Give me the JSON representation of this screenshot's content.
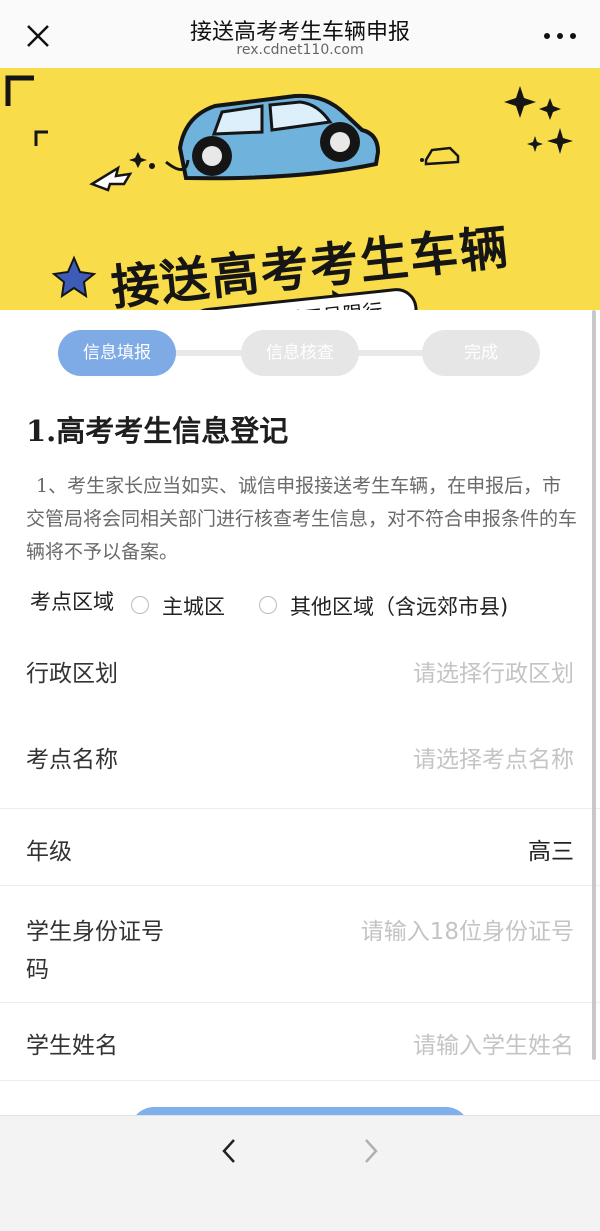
{
  "nav": {
    "title": "接送高考考生车辆申报",
    "url": "rex.cdnet110.com",
    "close_icon": "close-icon",
    "more_icon": "more-icon"
  },
  "banner": {
    "title": "接送高考考生车辆",
    "pill": "申报不受尾号限行",
    "colors": {
      "background": "#f8dc4a",
      "car": "#6fb3dc"
    }
  },
  "steps": [
    {
      "label": "信息填报",
      "active": true
    },
    {
      "label": "信息核查",
      "active": false
    },
    {
      "label": "完成",
      "active": false
    }
  ],
  "section": {
    "title": "1.高考考生信息登记",
    "notice": "1、考生家长应当如实、诚信申报接送考生车辆，在申报后，市交管局将会同相关部门进行核查考生信息，对不符合申报条件的车辆将不予以备案。"
  },
  "area": {
    "label": "考点区域",
    "options": [
      "主城区",
      "其他区域（含远郊市县)"
    ]
  },
  "fields": [
    {
      "label": "行政区划",
      "placeholder": "请选择行政区划"
    },
    {
      "label": "考点名称",
      "placeholder": "请选择考点名称"
    },
    {
      "label": "年级",
      "value": "高三"
    },
    {
      "label_line1": "学生身份证号",
      "label_line2": "码",
      "placeholder": "请输入18位身份证号"
    },
    {
      "label": "学生姓名",
      "placeholder": "请输入学生姓名"
    }
  ],
  "colors": {
    "accent": "#7eaae6",
    "step_inactive": "#e6e6e6",
    "placeholder": "#c4c4c4"
  },
  "bottom": {
    "back_icon": "chevron-left-icon",
    "forward_icon": "chevron-right-icon"
  }
}
